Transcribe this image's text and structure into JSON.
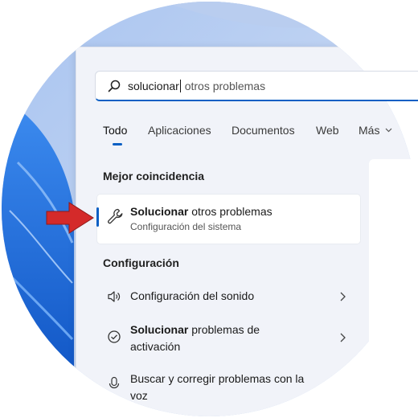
{
  "search": {
    "typed": "solucionar",
    "suggestion": " otros problemas"
  },
  "tabs": [
    "Todo",
    "Aplicaciones",
    "Documentos",
    "Web",
    "Más"
  ],
  "best_match": {
    "heading": "Mejor coincidencia",
    "title_bold": "Solucionar",
    "title_rest": " otros problemas",
    "subtitle": "Configuración del sistema"
  },
  "settings": {
    "heading": "Configuración",
    "items": [
      {
        "text": "Configuración del sonido"
      },
      {
        "bold": "Solucionar",
        "line1_rest": " problemas de",
        "line2": "activación"
      },
      {
        "line1": "Buscar y corregir problemas con la",
        "line2": "voz"
      }
    ]
  },
  "colors": {
    "accent": "#0a5fc4",
    "annotation_arrow": "#d42a2a",
    "wallpaper": "#1f6fe0"
  }
}
